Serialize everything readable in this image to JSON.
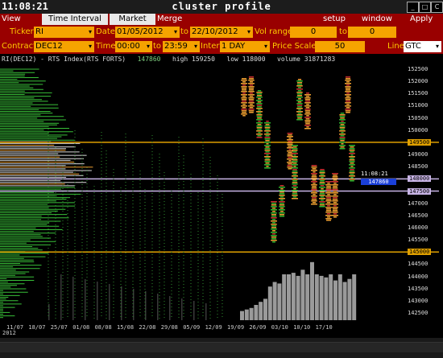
{
  "window": {
    "clock": "11:08:21",
    "title": "cluster profile",
    "ctrl_buttons": [
      "_",
      "□",
      "C"
    ]
  },
  "menu": {
    "items": [
      "View DOM",
      "Time Interval",
      "Market Watch",
      "Merge Contr"
    ],
    "setup": "setup",
    "window": "window",
    "apply": "Apply"
  },
  "filters": {
    "ticker_label": "Ticker",
    "ticker": "RI",
    "date_label": "Date",
    "date_from": "01/05/2012",
    "to_label": "to",
    "date_to": "22/10/2012",
    "vol_range_label": "Vol range",
    "vol_from": "0",
    "vol_to_label": "to",
    "vol_to": "0",
    "contract_label": "Contract",
    "contract": "DEC12",
    "time_label": "Time",
    "time_from": "00:00",
    "time_to_label": "to",
    "time_to": "23:59",
    "interval_label": "Interval",
    "interval": "1 DAY",
    "price_scale_label": "Price Scale",
    "price_scale": "50",
    "line_label": "Line",
    "line": "GTC"
  },
  "chart_info": {
    "symbol": "RI(DEC12) - RTS Index(RTS FORTS)",
    "last": "147860",
    "high": "high 159250",
    "low": "low 118000",
    "volume": "volume 31871283"
  },
  "chart_data": {
    "type": "bar",
    "y_ticks": [
      "152500",
      "152000",
      "151500",
      "151000",
      "150500",
      "150000",
      "149500",
      "149000",
      "148500",
      "148000",
      "147500",
      "147000",
      "146500",
      "146000",
      "145500",
      "145000",
      "144500",
      "144000",
      "143500",
      "143000",
      "142500"
    ],
    "x_ticks": [
      "11/07",
      "18/07",
      "25/07",
      "01/08",
      "08/08",
      "15/08",
      "22/08",
      "29/08",
      "05/09",
      "12/09",
      "19/09",
      "26/09",
      "03/10",
      "10/10",
      "17/10"
    ],
    "x_year": "2012",
    "clock_label": "11:08:21",
    "last_price": "147860",
    "levels": [
      {
        "price": 149500,
        "label": "149500",
        "color": "#e0a000"
      },
      {
        "price": 148000,
        "label": "148000",
        "color": "#c8b4e6"
      },
      {
        "price": 147500,
        "label": "147500",
        "color": "#c8b4e6"
      },
      {
        "price": 145000,
        "label": "145000",
        "color": "#e0a000"
      }
    ],
    "volume_bars": [
      6,
      7,
      8,
      10,
      12,
      14,
      22,
      25,
      24,
      30,
      30,
      31,
      29,
      33,
      30,
      38,
      30,
      29,
      28,
      30,
      26,
      30,
      25,
      27,
      30
    ]
  }
}
